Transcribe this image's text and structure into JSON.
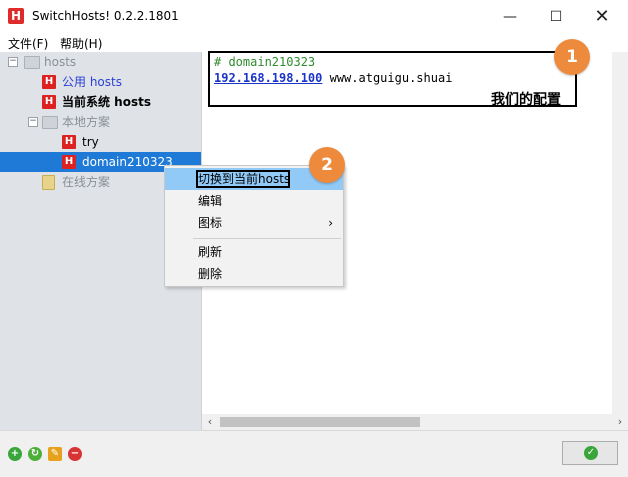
{
  "window": {
    "title": "SwitchHosts! 0.2.2.1801",
    "app_icon_letter": "H"
  },
  "menubar": {
    "items": [
      "文件(F)",
      "帮助(H)"
    ]
  },
  "sidebar": {
    "root": "hosts",
    "public": "公用 hosts",
    "current": "当前系统 hosts",
    "local": "本地方案",
    "local_items": [
      "try",
      "domain210323"
    ],
    "online": "在线方案"
  },
  "editor": {
    "line1": "# domain210323",
    "line2_ip": "192.168.198.100",
    "line2_host": "www.atguigu.shuai",
    "annotation_caption": "我们的配置"
  },
  "badges": {
    "one": "1",
    "two": "2"
  },
  "context_menu": {
    "items": [
      "切换到当前hosts",
      "编辑",
      "图标",
      "刷新",
      "删除"
    ],
    "submenu_arrow": "›"
  },
  "colors": {
    "selection": "#1e7ad6",
    "badge": "#ee8a3c",
    "menu_highlight": "#91c9f7"
  }
}
